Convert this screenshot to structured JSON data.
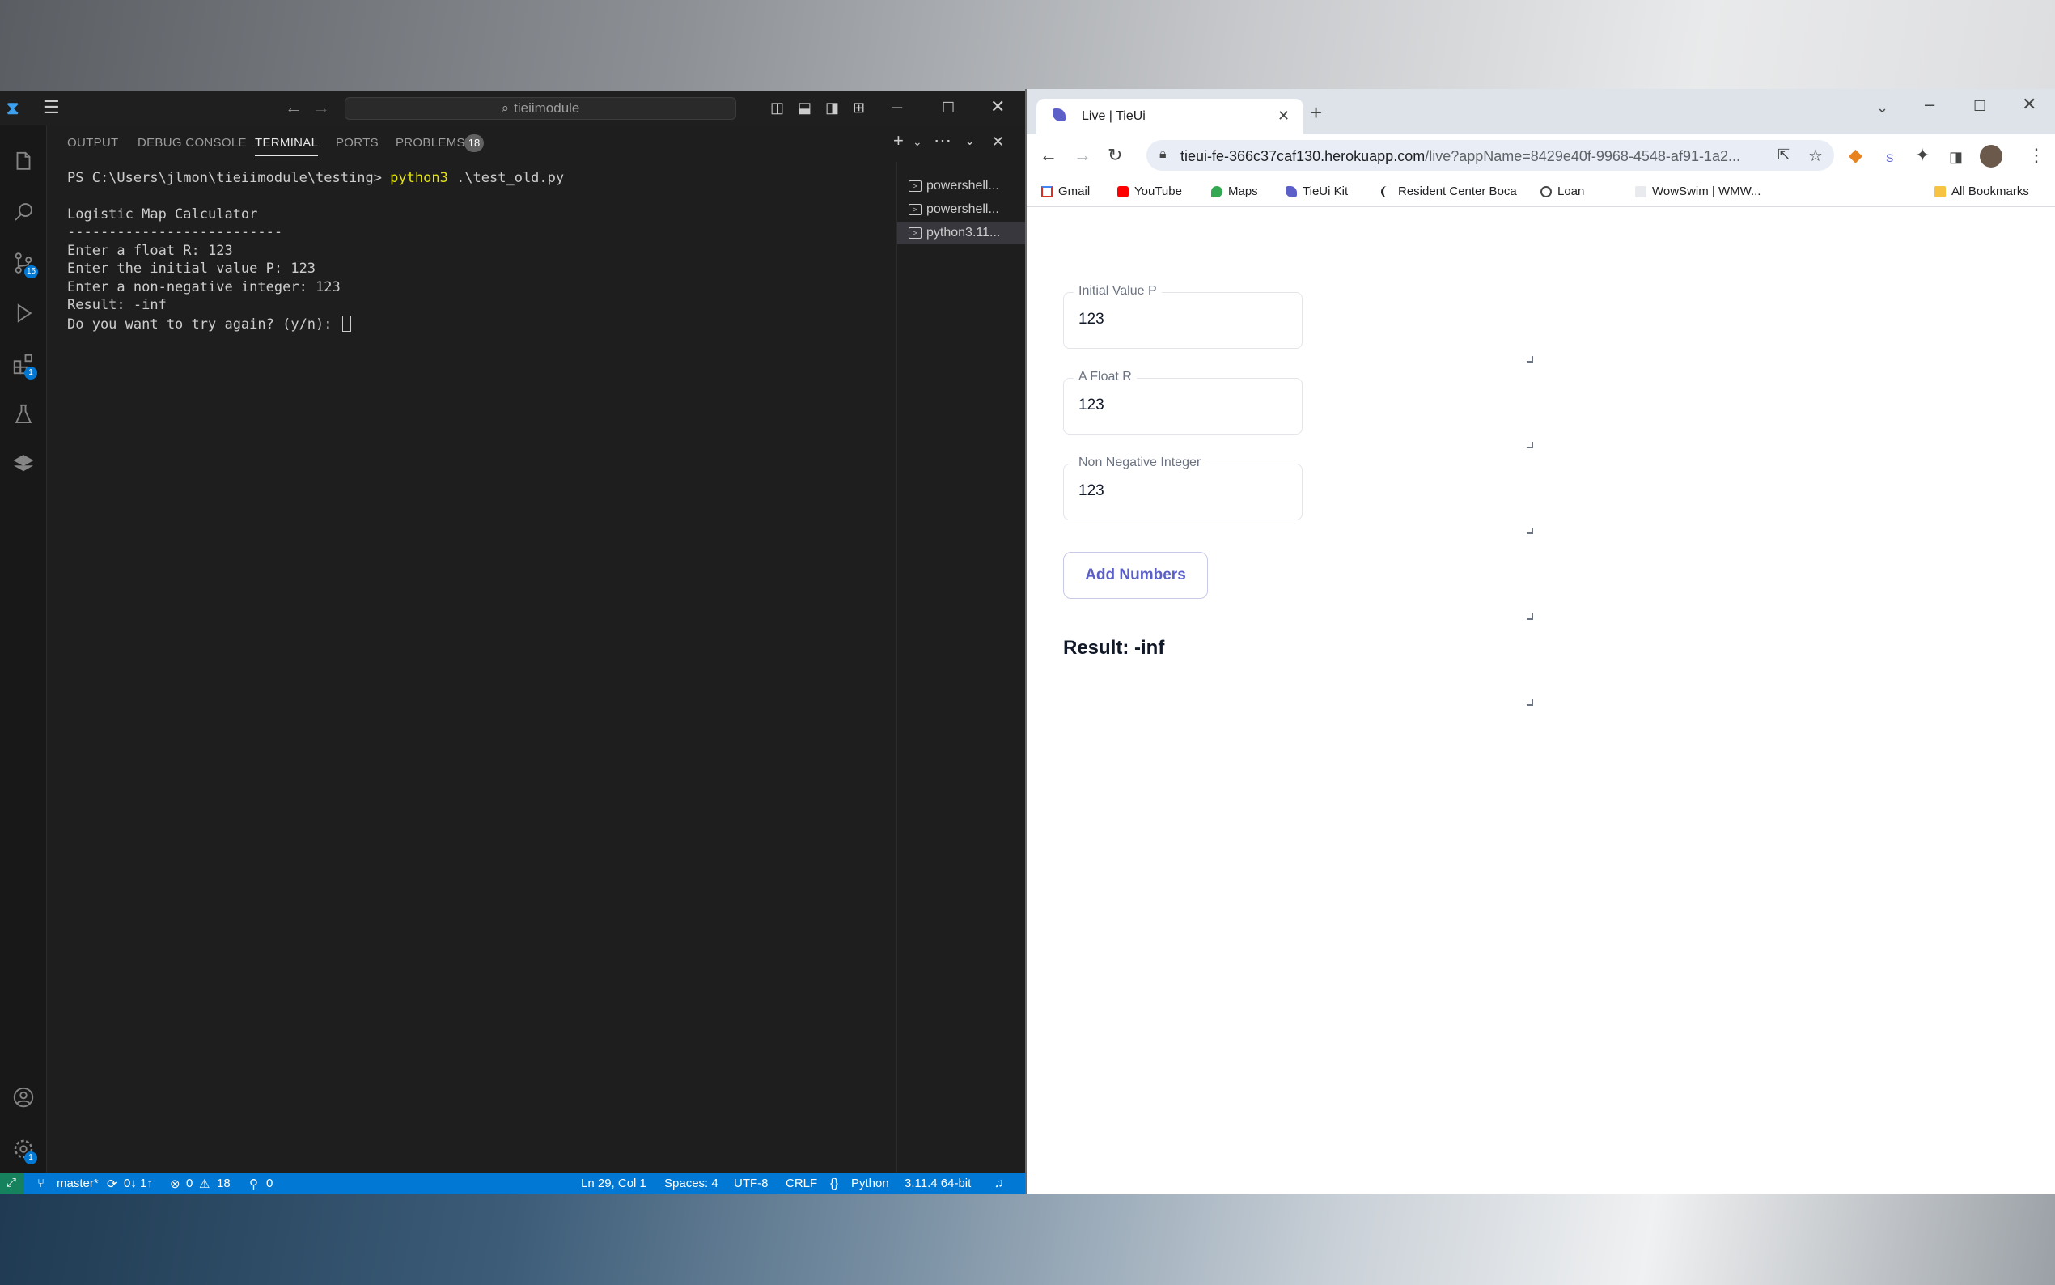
{
  "vscode": {
    "search_text": "tieiimodule",
    "panel_tabs": [
      "OUTPUT",
      "DEBUG CONSOLE",
      "TERMINAL",
      "PORTS",
      "PROBLEMS"
    ],
    "problems_count": "18",
    "activity_badges": {
      "source_control": "15",
      "extensions": "1",
      "settings": "1"
    },
    "terminal": {
      "prompt": "PS C:\\Users\\jlmon\\tieiimodule\\testing> ",
      "command": "python3",
      "args": " .\\test_old.py",
      "lines": [
        "Logistic Map Calculator",
        "--------------------------",
        "Enter a float R: 123",
        "Enter the initial value P: 123",
        "Enter a non-negative integer: 123",
        "Result: -inf",
        "Do you want to try again? (y/n): "
      ]
    },
    "terminal_list": [
      "powershell...",
      "powershell...",
      "python3.11..."
    ],
    "status": {
      "branch": "master*",
      "sync": "0↓ 1↑",
      "errors": "0",
      "warnings": "18",
      "ports": "0",
      "position": "Ln 29, Col 1",
      "spaces": "Spaces: 4",
      "encoding": "UTF-8",
      "eol": "CRLF",
      "language": "Python",
      "interpreter": "3.11.4 64-bit"
    }
  },
  "chrome": {
    "tab_title": "Live | TieUi",
    "url_host": "tieui-fe-366c37caf130.herokuapp.com",
    "url_path": "/live?appName=8429e40f-9968-4548-af91-1a2...",
    "bookmarks": [
      "Gmail",
      "YouTube",
      "Maps",
      "TieUi Kit",
      "Resident Center Boca",
      "Loan",
      "WowSwim | WMW...",
      "All Bookmarks"
    ]
  },
  "app": {
    "fields": [
      {
        "label": "Initial Value P",
        "value": "123"
      },
      {
        "label": "A Float R",
        "value": "123"
      },
      {
        "label": "Non Negative Integer",
        "value": "123"
      }
    ],
    "button_label": "Add Numbers",
    "result_text": "Result: -inf"
  },
  "colors": {
    "vscode_status": "#0078d4",
    "remote_indicator": "#16825d",
    "button_text": "#5b5fc7",
    "terminal_command": "#e5e510"
  }
}
